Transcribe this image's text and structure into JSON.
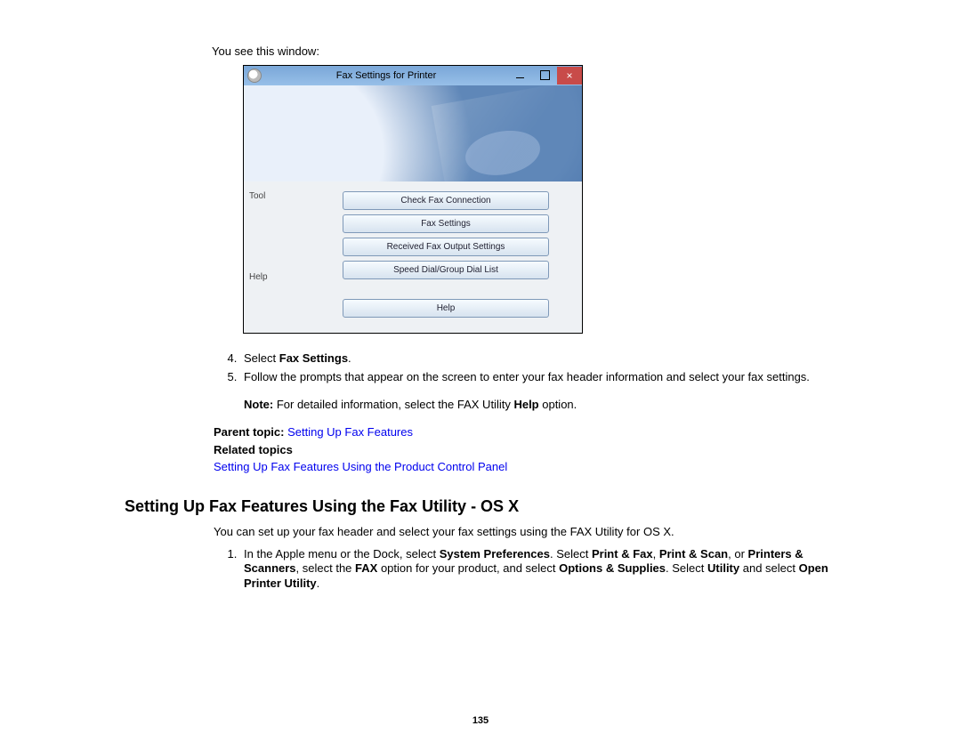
{
  "intro": "You see this window:",
  "window": {
    "title": "Fax Settings for Printer",
    "side": {
      "tool": "Tool",
      "help": "Help"
    },
    "buttons": {
      "check": "Check Fax Connection",
      "settings": "Fax Settings",
      "received": "Received Fax Output Settings",
      "speed": "Speed Dial/Group Dial List",
      "help": "Help"
    }
  },
  "steps_start": 4,
  "step4_pre": "Select ",
  "step4_strong": "Fax Settings",
  "step4_post": ".",
  "step5": "Follow the prompts that appear on the screen to enter your fax header information and select your fax settings.",
  "note_label": "Note:",
  "note_text_pre": " For detailed information, select the FAX Utility ",
  "note_help": "Help",
  "note_text_post": " option.",
  "parent_label": "Parent topic: ",
  "parent_link": "Setting Up Fax Features",
  "related_label": "Related topics",
  "related_link": "Setting Up Fax Features Using the Product Control Panel",
  "section_heading": "Setting Up Fax Features Using the Fax Utility - OS X",
  "section_body": "You can set up your fax header and select your fax settings using the FAX Utility for OS X.",
  "osx_step1": {
    "pre": "In the Apple menu or the Dock, select ",
    "b1": "System Preferences",
    "t1": ". Select ",
    "b2": "Print & Fax",
    "t2": ", ",
    "b3": "Print & Scan",
    "t3": ", or ",
    "b4": "Printers & Scanners",
    "t4": ", select the ",
    "b5": "FAX",
    "t5": " option for your product, and select ",
    "b6": "Options & Supplies",
    "t6": ". Select ",
    "b7": "Utility",
    "t7": " and select ",
    "b8": "Open Printer Utility",
    "t8": "."
  },
  "page_number": "135"
}
